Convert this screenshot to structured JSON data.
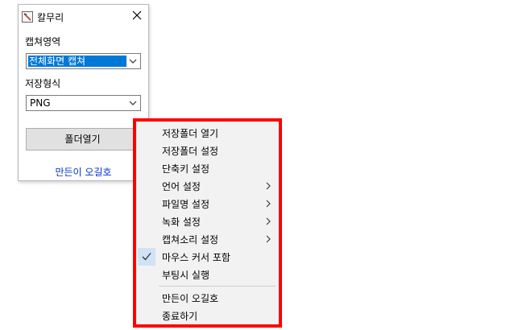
{
  "window": {
    "title": "칼무리",
    "capture_area_label": "캡쳐영역",
    "capture_area_value": "전체화면 캡쳐",
    "save_format_label": "저장형식",
    "save_format_value": "PNG",
    "open_folder_button": "폴더열기",
    "maker_link": "만든이 오길호"
  },
  "context_menu": {
    "items": [
      {
        "label": "저장폴더 열기"
      },
      {
        "label": "저장폴더 설정"
      },
      {
        "label": "단축키 설정"
      },
      {
        "label": "언어 설정",
        "submenu": true
      },
      {
        "label": "파일명 설정",
        "submenu": true
      },
      {
        "label": "녹화 설정",
        "submenu": true
      },
      {
        "label": "캡쳐소리 설정",
        "submenu": true
      },
      {
        "label": "마우스 커서 포함",
        "checked": true
      },
      {
        "label": "부팅시 실행"
      },
      {
        "label": "만든이 오길호"
      },
      {
        "label": "종료하기"
      }
    ]
  },
  "colors": {
    "highlight": "#0078d7",
    "menu_border": "#ff0000",
    "link": "#0033cc"
  }
}
